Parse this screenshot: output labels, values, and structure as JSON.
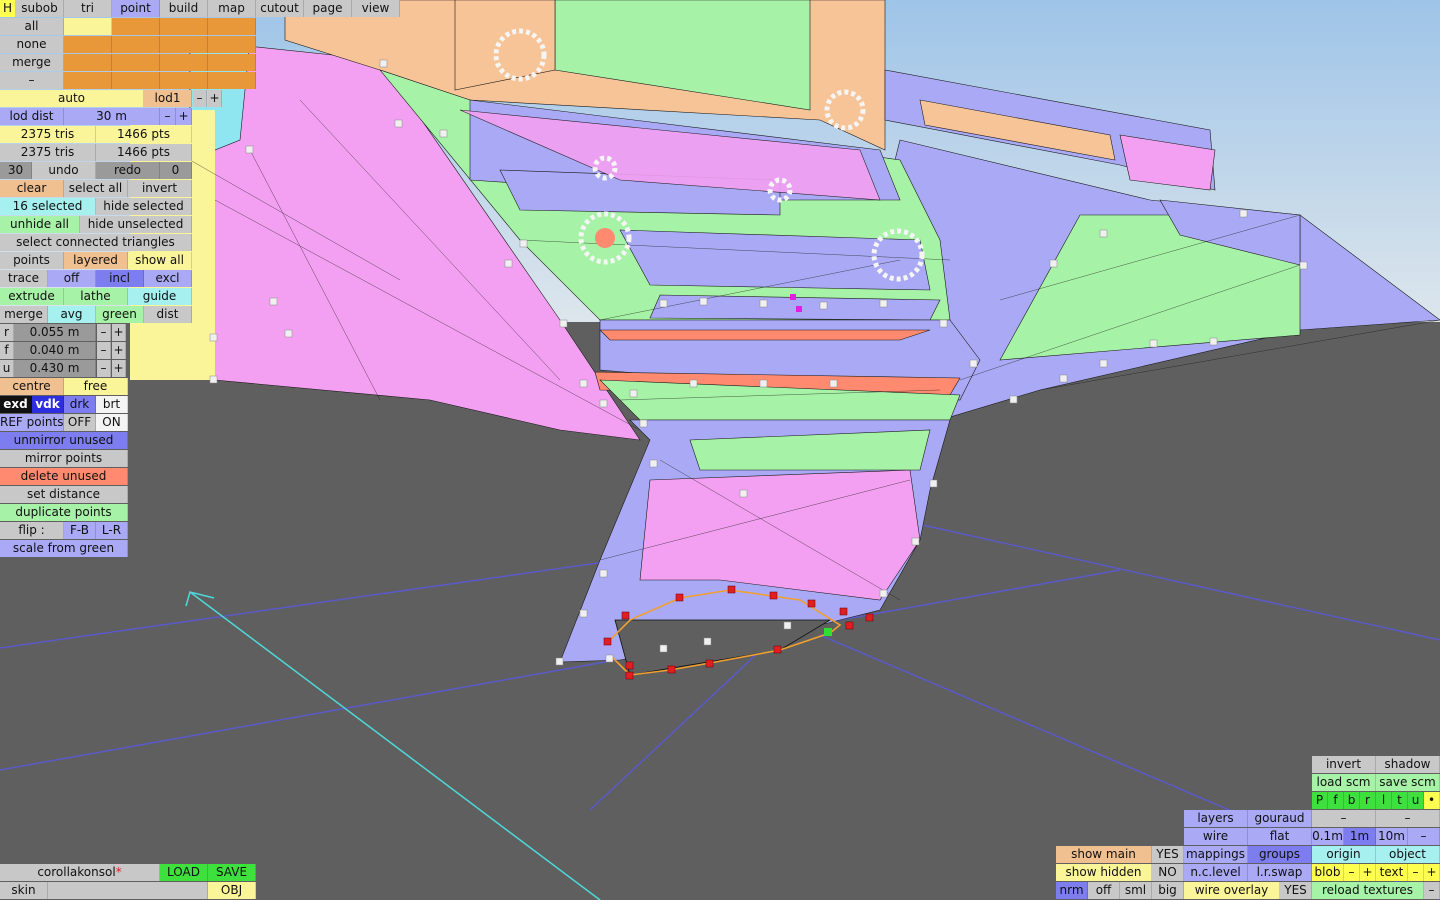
{
  "menu": {
    "h": "H",
    "tabs": [
      "subob",
      "tri",
      "point",
      "build",
      "map",
      "cutout",
      "page",
      "view"
    ]
  },
  "left_panel": {
    "sel_all": "all",
    "sel_none": "none",
    "sel_merge": "merge",
    "sel_minus": "–",
    "auto": "auto",
    "lod": "lod1",
    "minus": "–",
    "plus": "+",
    "lod_dist_label": "lod dist",
    "lod_dist_value": "30 m",
    "tris_1": "2375 tris",
    "pts_1": "1466 pts",
    "tris_2": "2375 tris",
    "pts_2": "1466 pts",
    "undo_count": "30",
    "undo": "undo",
    "redo": "redo",
    "redo_count": "0",
    "clear": "clear",
    "select_all": "select all",
    "invert": "invert",
    "selected": "16 selected",
    "hide_selected": "hide selected",
    "unhide_all": "unhide all",
    "hide_unselected": "hide unselected",
    "select_connected": "select connected triangles",
    "points": "points",
    "layered": "layered",
    "show_all": "show all",
    "trace": "trace",
    "off": "off",
    "incl": "incl",
    "excl": "excl",
    "extrude": "extrude",
    "lathe": "lathe",
    "guide": "guide",
    "merge2": "merge",
    "avg": "avg",
    "green": "green",
    "dist": "dist",
    "r_label": "r",
    "r_value": "0.055 m",
    "f_label": "f",
    "f_value": "0.040 m",
    "u_label": "u",
    "u_value": "0.430 m",
    "centre": "centre",
    "free": "free",
    "exd": "exd",
    "vdk": "vdk",
    "drk": "drk",
    "brt": "brt",
    "ref_points": "REF points",
    "ref_off": "OFF",
    "ref_on": "ON",
    "unmirror_unused": "unmirror unused",
    "mirror_points": "mirror points",
    "delete_unused": "delete unused",
    "set_distance": "set distance",
    "duplicate_points": "duplicate points",
    "flip": "flip :",
    "flip_fb": "F-B",
    "flip_lr": "L-R",
    "scale_from_green": "scale from green"
  },
  "bottom_left": {
    "filename": "corollakonsol",
    "modified_mark": "*",
    "load": "LOAD",
    "save": "SAVE",
    "skin": "skin",
    "obj": "OBJ"
  },
  "bottom_right": {
    "show_main": "show main",
    "show_main_val": "YES",
    "show_hidden": "show hidden",
    "show_hidden_val": "NO",
    "nrm": "nrm",
    "off": "off",
    "sml": "sml",
    "big": "big",
    "layers": "layers",
    "gouraud": "gouraud",
    "wire": "wire",
    "flat": "flat",
    "mappings": "mappings",
    "groups": "groups",
    "nc_level": "n.c.level",
    "lr_swap": "l.r.swap",
    "wire_overlay": "wire overlay",
    "wire_overlay_val": "YES",
    "invert": "invert",
    "shadow": "shadow",
    "load_scm": "load scm",
    "save_scm": "save scm",
    "views": [
      "P",
      "f",
      "b",
      "r",
      "l",
      "t",
      "u"
    ],
    "dot": "•",
    "dash1": "–",
    "dash2": "–",
    "step_01": "0.1m",
    "step_1": "1m",
    "step_10": "10m",
    "step_minus": "–",
    "origin": "origin",
    "object": "object",
    "blob": "blob",
    "blob_minus": "–",
    "blob_plus": "+",
    "text": "text",
    "text_minus": "–",
    "text_plus": "+",
    "reload_textures": "reload textures",
    "reload_minus": "–"
  }
}
